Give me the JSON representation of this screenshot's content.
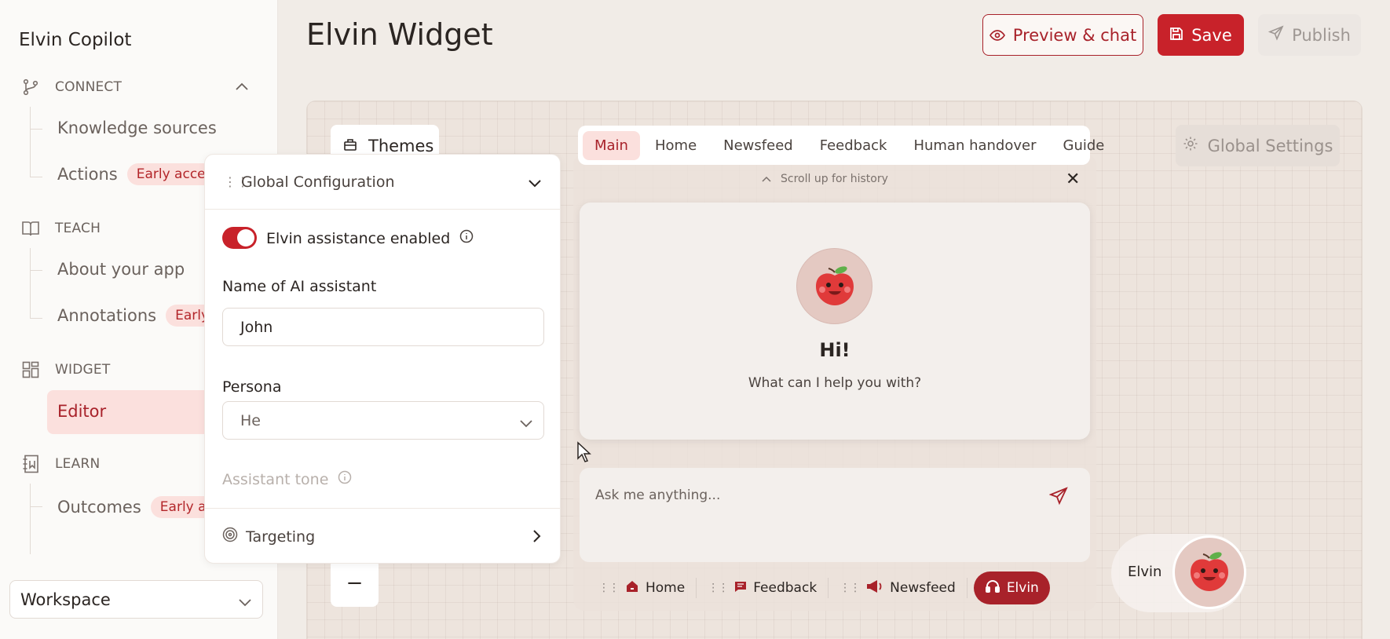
{
  "sidebar": {
    "app_title": "Elvin Copilot",
    "sections": {
      "connect": {
        "label": "CONNECT",
        "icon": "git-branch-icon"
      },
      "teach": {
        "label": "TEACH",
        "icon": "book-icon"
      },
      "widget": {
        "label": "WIDGET",
        "icon": "grid-icon"
      },
      "learn": {
        "label": "LEARN",
        "icon": "notebook-icon"
      }
    },
    "items": {
      "knowledge_sources": "Knowledge sources",
      "actions": "Actions",
      "actions_badge": "Early access",
      "about_app": "About your app",
      "annotations": "Annotations",
      "annotations_badge": "Early a",
      "editor": "Editor",
      "outcomes": "Outcomes",
      "outcomes_badge": "Early acc"
    },
    "workspace": "Workspace"
  },
  "header": {
    "title": "Elvin Widget",
    "preview_label": "Preview & chat",
    "save_label": "Save",
    "publish_label": "Publish"
  },
  "canvas": {
    "themes_label": "Themes",
    "zoom_out_label": "−",
    "global_settings_label": "Global Settings"
  },
  "config": {
    "title": "Global Configuration",
    "toggle_label": "Elvin assistance enabled",
    "toggle_on": true,
    "name_label": "Name of AI assistant",
    "name_value": "John",
    "persona_label": "Persona",
    "persona_value": "He",
    "tone_label": "Assistant tone",
    "targeting_label": "Targeting"
  },
  "widget": {
    "tabs": [
      "Main",
      "Home",
      "Newsfeed",
      "Feedback",
      "Human handover",
      "Guide"
    ],
    "active_tab": "Main",
    "scroll_hint": "Scroll up for history",
    "close": "✕",
    "greeting": "Hi!",
    "subtext": "What can I help you with?",
    "input_placeholder": "Ask me anything...",
    "bottom_nav": {
      "home": "Home",
      "feedback": "Feedback",
      "newsfeed": "Newsfeed",
      "elvin": "Elvin"
    },
    "launcher_label": "Elvin"
  },
  "colors": {
    "accent": "#c8222a",
    "accent_dark": "#a8222a",
    "badge_bg": "#fbe0dd"
  }
}
